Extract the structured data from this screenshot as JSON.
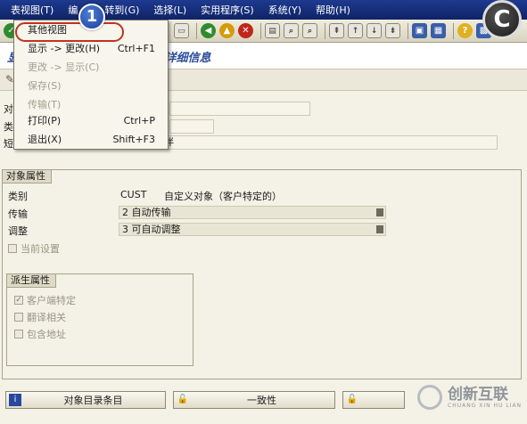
{
  "menubar": {
    "items": [
      "表视图(T)",
      "编",
      "转到(G)",
      "选择(L)",
      "实用程序(S)",
      "系统(Y)",
      "帮助(H)"
    ]
  },
  "title": {
    "text": "显示 -> 更改对象\"\"：详细信息",
    "visible_text": "\"\"：详细信息",
    "prefix": "显"
  },
  "header": {
    "label_obj": "对象",
    "label_type": "类型",
    "label_short": "短文本",
    "short_text_value": "伙伴"
  },
  "object_attributes": {
    "title": "对象属性",
    "rows": [
      {
        "label": "类别",
        "value": "CUST",
        "description": "自定义对象（客户特定的）"
      },
      {
        "label": "传输",
        "value": "2 自动传输"
      },
      {
        "label": "调整",
        "value": "3 可自动调整"
      }
    ],
    "current_setting": "当前设置"
  },
  "derived_attributes": {
    "title": "派生属性",
    "items": [
      {
        "label": "客户端特定",
        "checked": true
      },
      {
        "label": "翻译相关",
        "checked": false
      },
      {
        "label": "包含地址",
        "checked": false
      }
    ]
  },
  "bottom_buttons": {
    "catalog": "对象目录条目",
    "consistency": "一致性"
  },
  "popup_menu": {
    "items": [
      {
        "label": "其他视图",
        "shortcut": "",
        "enabled": true
      },
      {
        "label": "显示 -> 更改(H)",
        "shortcut": "Ctrl+F1",
        "enabled": true
      },
      {
        "label": "更改 -> 显示(C)",
        "shortcut": "",
        "enabled": false
      },
      {
        "label": "保存(S)",
        "shortcut": "",
        "enabled": false
      },
      {
        "label": "传输(T)",
        "shortcut": "",
        "enabled": false
      },
      {
        "label": "打印(P)",
        "shortcut": "Ctrl+P",
        "enabled": true
      },
      {
        "label": "退出(X)",
        "shortcut": "Shift+F3",
        "enabled": true
      }
    ]
  },
  "callout": {
    "number": "1"
  },
  "corner_badge": {
    "letter": "C"
  },
  "watermark": {
    "name": "创新互联",
    "sub": "CHUANG XIN HU LIAN"
  },
  "colors": {
    "menubar": "#1e3a8f",
    "highlight": "#c2321f",
    "title": "#2b4c9b"
  }
}
